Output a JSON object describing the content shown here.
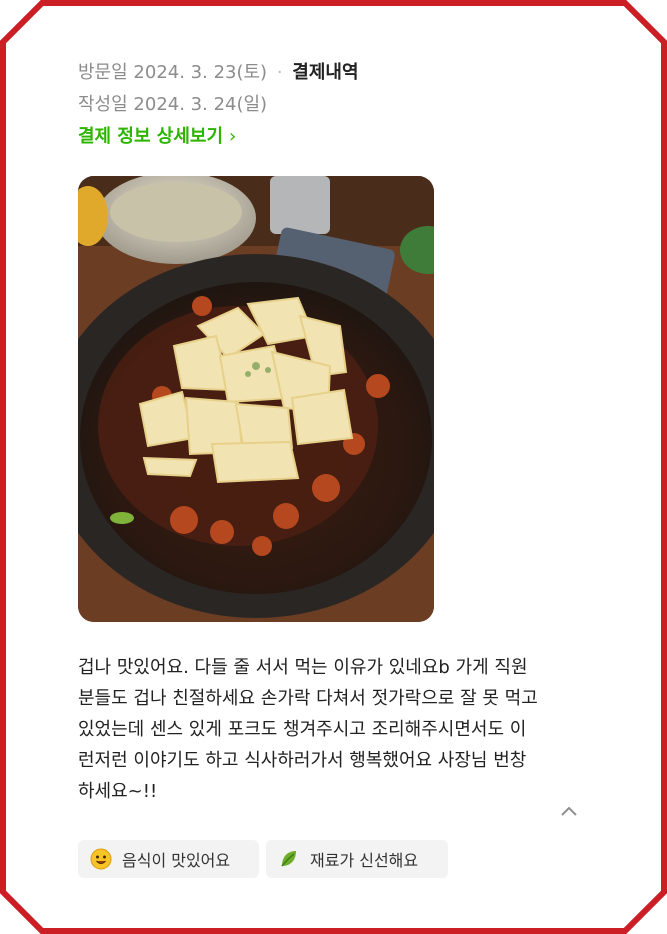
{
  "visit": {
    "label": "방문일",
    "date": "2024. 3. 23(토)",
    "separator": "·",
    "receipt": "결제내역"
  },
  "written": {
    "label": "작성일",
    "date": "2024. 3. 24(일)"
  },
  "payment_link": {
    "label": "결제 정보 상세보기",
    "chevron": "›"
  },
  "photo": {
    "icon": "food-photo"
  },
  "review": {
    "lines": [
      "겁나 맛있어요. 다들 줄 서서 먹는 이유가 있네요b 가게 직원",
      "분들도 겁나 친절하세요 손가락 다쳐서 젓가락으로 잘 못 먹고",
      "있었는데 센스 있게 포크도 챙겨주시고 조리해주시면서도 이",
      "런저런 이야기도 하고 식사하러가서 행복했어요 사장님 번창",
      "하세요~!!"
    ],
    "collapse_icon": "chevron-up-icon"
  },
  "tags": [
    {
      "label": "음식이 맛있어요",
      "icon": "smiley-icon"
    },
    {
      "label": "재료가 신선해요",
      "icon": "leaf-icon"
    }
  ],
  "colors": {
    "frame": "#cc1f25",
    "accent": "#2db400",
    "chip_bg": "#f3f3f3"
  }
}
